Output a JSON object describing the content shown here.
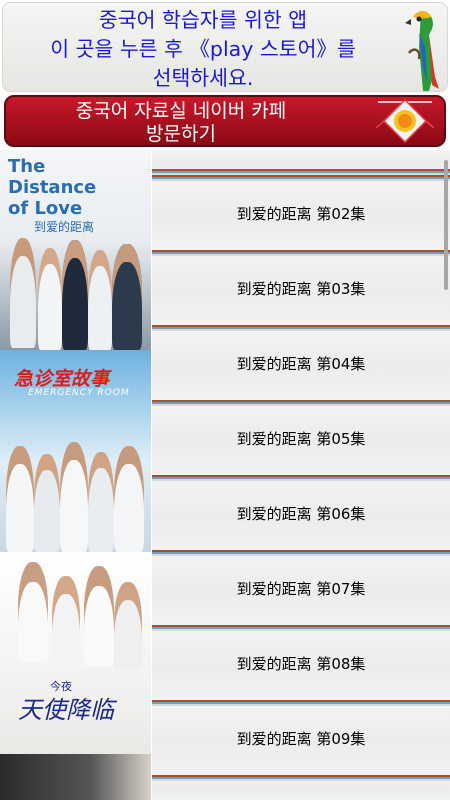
{
  "top_banner": {
    "line1": "중국어 학습자를 위한 앱",
    "line2": "이 곳을 누른 후 《play 스토어》를",
    "line3": "선택하세요.",
    "icon": "parrot-icon"
  },
  "cafe_banner": {
    "line1": "중국어 자료실 네이버 카페",
    "line2": "방문하기",
    "icon": "lantern-icon"
  },
  "posters": [
    {
      "title": "The Distance of Love",
      "subtitle": "到爱的距离"
    },
    {
      "title": "急诊室故事",
      "subtitle": "EMERGENCY ROOM"
    },
    {
      "title": "天使降临",
      "subtitle": "今夜"
    }
  ],
  "episodes": [
    {
      "label": "到爱的距离 第02集"
    },
    {
      "label": "到爱的距离 第03集"
    },
    {
      "label": "到爱的距离 第04集"
    },
    {
      "label": "到爱的距离 第05集"
    },
    {
      "label": "到爱的距离 第06集"
    },
    {
      "label": "到爱的距离 第07集"
    },
    {
      "label": "到爱的距离 第08集"
    },
    {
      "label": "到爱的距离 第09集"
    }
  ],
  "colors": {
    "banner_text": "#1a1ad6",
    "cafe_bg": "#b01222",
    "stripe_red": "#a94f2e",
    "stripe_blue": "#6d9fbf"
  }
}
